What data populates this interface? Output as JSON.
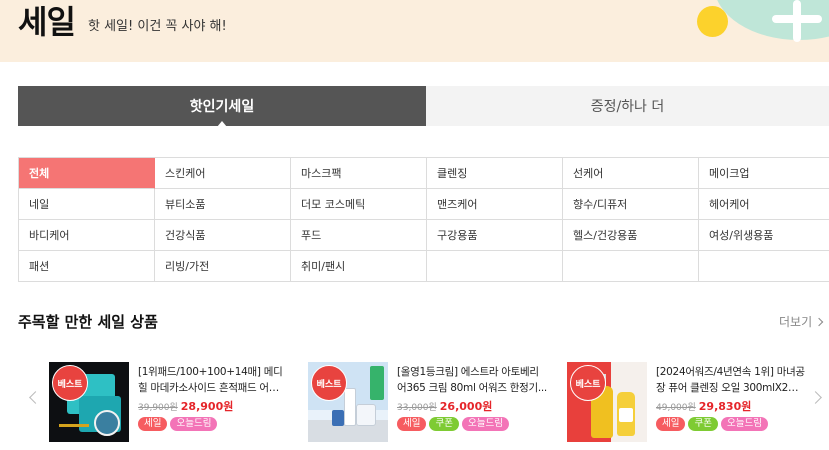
{
  "banner": {
    "title": "세일",
    "subtitle": "핫 세일! 이건 꼭 사야 해!"
  },
  "tabs": [
    {
      "label": "핫인기세일",
      "active": true
    },
    {
      "label": "증정/하나 더",
      "active": false
    }
  ],
  "categories": [
    "전체",
    "스킨케어",
    "마스크팩",
    "클렌징",
    "선케어",
    "메이크업",
    "네일",
    "뷰티소품",
    "더모 코스메틱",
    "맨즈케어",
    "향수/디퓨저",
    "헤어케어",
    "바디케어",
    "건강식품",
    "푸드",
    "구강용품",
    "헬스/건강용품",
    "여성/위생용품",
    "패션",
    "리빙/가전",
    "취미/팬시",
    "",
    "",
    ""
  ],
  "active_category": "전체",
  "section": {
    "title": "주목할 만한 세일 상품",
    "more_label": "더보기"
  },
  "products": [
    {
      "badge": "베스트",
      "name": "[1위패드/100+100+14매] 메디힐 마데카소사이드 흔적패드 어워즈...",
      "original_price": "39,900원",
      "sale_price": "28,900원",
      "flags": [
        "세일",
        "오늘드림"
      ]
    },
    {
      "badge": "베스트",
      "name": "[올영1등크림] 에스트라 아토베리어365 크림 80ml 어워즈 한정기...",
      "original_price": "33,000원",
      "sale_price": "26,000원",
      "flags": [
        "세일",
        "쿠폰",
        "오늘드림"
      ]
    },
    {
      "badge": "베스트",
      "name": "[2024어워즈/4년연속 1위] 마녀공장 퓨어 클렌징 오일 300mlX2 어...",
      "original_price": "49,000원",
      "sale_price": "29,830원",
      "flags": [
        "세일",
        "쿠폰",
        "오늘드림"
      ]
    }
  ],
  "colors": {
    "banner_bg": "#fbeedd",
    "active_tab_bg": "#555555",
    "active_category_bg": "#f57574",
    "sale_price": "#e5252a",
    "flag_sale": "#f65c60",
    "flag_coupon": "#7ecb33",
    "flag_today": "#f374b7"
  }
}
